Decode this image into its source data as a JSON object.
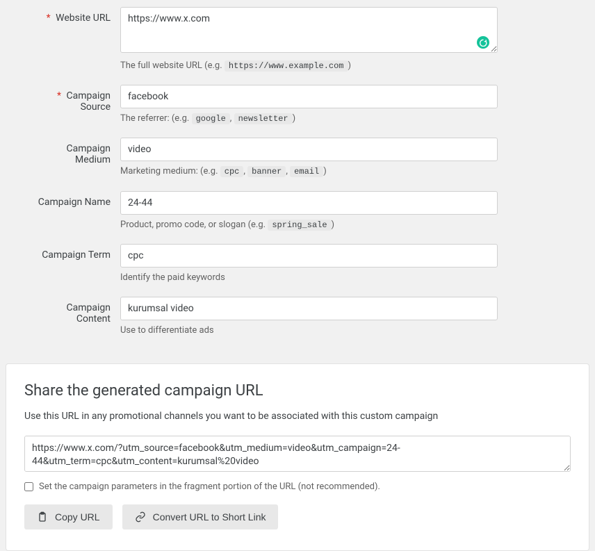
{
  "fields": {
    "websiteUrl": {
      "label": "Website URL",
      "value": "https://www.x.com",
      "helpPrefix": "The full website URL (e.g. ",
      "helpCode": "https://www.example.com",
      "helpSuffix": ")"
    },
    "campaignSource": {
      "label": "Campaign Source",
      "value": "facebook",
      "helpPrefix": "The referrer: (e.g. ",
      "helpCode1": "google",
      "helpSep": ", ",
      "helpCode2": "newsletter",
      "helpSuffix": ")"
    },
    "campaignMedium": {
      "label": "Campaign Medium",
      "value": "video",
      "helpPrefix": "Marketing medium: (e.g. ",
      "helpCode1": "cpc",
      "helpSep": ", ",
      "helpCode2": "banner",
      "helpCode3": "email",
      "helpSuffix": ")"
    },
    "campaignName": {
      "label": "Campaign Name",
      "value": "24-44",
      "helpPrefix": "Product, promo code, or slogan (e.g. ",
      "helpCode": "spring_sale",
      "helpSuffix": ")"
    },
    "campaignTerm": {
      "label": "Campaign Term",
      "value": "cpc",
      "help": "Identify the paid keywords"
    },
    "campaignContent": {
      "label": "Campaign Content",
      "value": "kurumsal video",
      "help": "Use to differentiate ads"
    }
  },
  "share": {
    "heading": "Share the generated campaign URL",
    "description": "Use this URL in any promotional channels you want to be associated with this custom campaign",
    "generatedUrl": "https://www.x.com/?utm_source=facebook&utm_medium=video&utm_campaign=24-44&utm_term=cpc&utm_content=kurumsal%20video",
    "fragmentCheckboxLabel": "Set the campaign parameters in the fragment portion of the URL (not recommended).",
    "copyButton": "Copy URL",
    "convertButton": "Convert URL to Short Link"
  }
}
